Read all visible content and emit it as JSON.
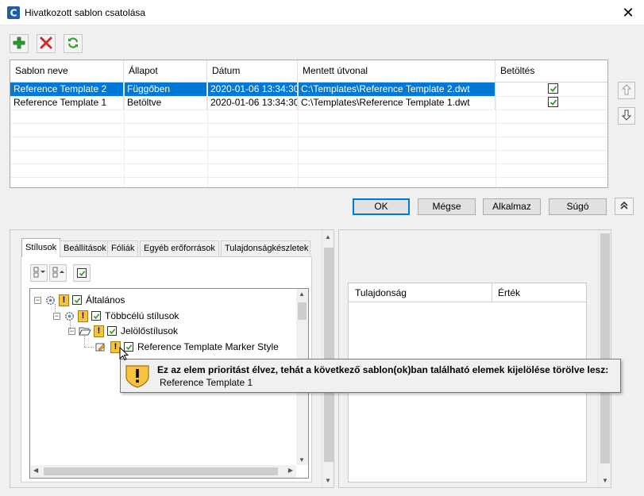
{
  "window": {
    "title": "Hivatkozott sablon csatolása",
    "close_glyph": "✕"
  },
  "toolbar": {
    "add_icon": "plus-icon",
    "delete_icon": "delete-x-icon",
    "refresh_icon": "refresh-icon"
  },
  "grid": {
    "columns": [
      "Sablon neve",
      "Állapot",
      "Dátum",
      "Mentett útvonal",
      "Betöltés"
    ],
    "rows": [
      {
        "name": "Reference Template 2",
        "status": "Függőben",
        "date": "2020-01-06 13:34:30",
        "path": "C:\\Templates\\Reference Template 2.dwt",
        "load": true,
        "selected": true
      },
      {
        "name": "Reference Template 1",
        "status": "Betöltve",
        "date": "2020-01-06 13:34:30",
        "path": "C:\\Templates\\Reference Template 1.dwt",
        "load": true,
        "selected": false
      }
    ]
  },
  "buttons": {
    "ok": "OK",
    "cancel": "Mégse",
    "apply": "Alkalmaz",
    "help": "Súgó"
  },
  "tabs": [
    "Stílusok",
    "Beállítások",
    "Fóliák",
    "Egyéb erőforrások",
    "Tulajdonságkészletek"
  ],
  "tree": {
    "root": "Általános",
    "level1": "Többcélú stílusok",
    "level2": "Jelölőstílusok",
    "level3": "Reference Template Marker Style"
  },
  "tooltip": {
    "message": "Ez az elem prioritást élvez, tehát a következő sablon(ok)ban található elemek kijelölése törölve lesz:",
    "item": "Reference Template 1"
  },
  "properties": {
    "col_property": "Tulajdonság",
    "col_value": "Érték"
  },
  "colors": {
    "selection": "#0078d7",
    "warning": "#f6c33f",
    "add": "#2e9b2e",
    "delete": "#d9262b"
  }
}
